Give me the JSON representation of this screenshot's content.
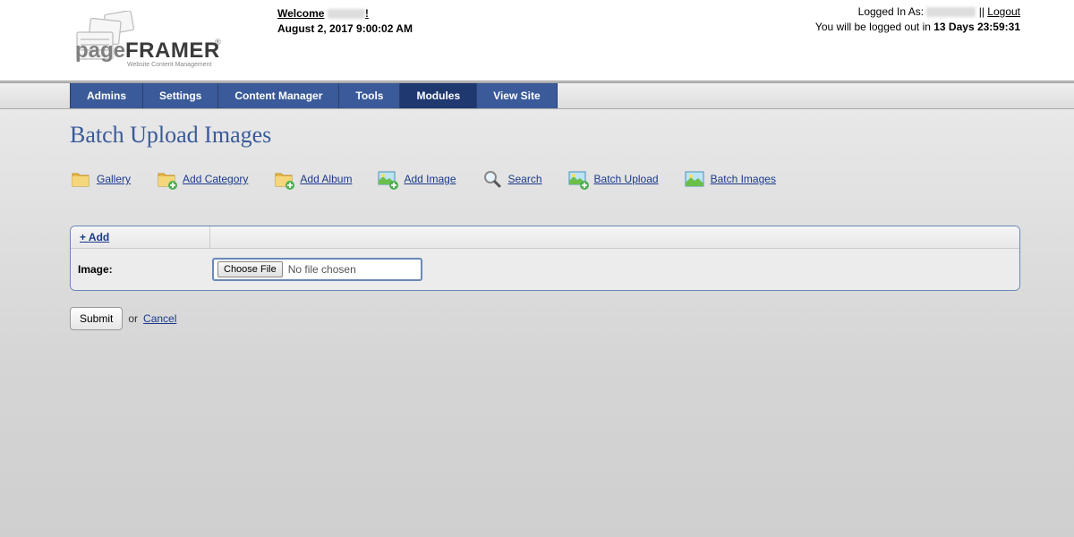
{
  "header": {
    "welcome_label": "Welcome",
    "welcome_bang": "!",
    "date": "August 2, 2017 9:00:02 AM",
    "logged_in_as_label": "Logged In As:",
    "sep": " || ",
    "logout": "Logout",
    "logout_warn_pre": "You will be logged out in ",
    "logout_countdown": "13 Days 23:59:31"
  },
  "logo": {
    "brand1": "page",
    "brand2": "FRAMER",
    "tagline": "Website Content Management",
    "reg": "®"
  },
  "nav": {
    "items": [
      {
        "label": "Admins",
        "active": false
      },
      {
        "label": "Settings",
        "active": false
      },
      {
        "label": "Content Manager",
        "active": false
      },
      {
        "label": "Tools",
        "active": false
      },
      {
        "label": "Modules",
        "active": true
      },
      {
        "label": "View Site",
        "active": false
      }
    ]
  },
  "page_title": "Batch Upload Images",
  "toolbar": {
    "items": [
      {
        "icon": "folder",
        "label": "Gallery"
      },
      {
        "icon": "folder-plus",
        "label": "Add Category"
      },
      {
        "icon": "folder-plus",
        "label": "Add Album"
      },
      {
        "icon": "image-plus",
        "label": "Add Image"
      },
      {
        "icon": "magnify",
        "label": "Search"
      },
      {
        "icon": "image-plus",
        "label": "Batch Upload"
      },
      {
        "icon": "image",
        "label": "Batch Images"
      }
    ]
  },
  "add_section": {
    "add_link": "+ Add",
    "image_label": "Image:",
    "choose_btn": "Choose File",
    "no_file": "No file chosen"
  },
  "actions": {
    "submit": "Submit",
    "or": "or",
    "cancel": "Cancel"
  }
}
